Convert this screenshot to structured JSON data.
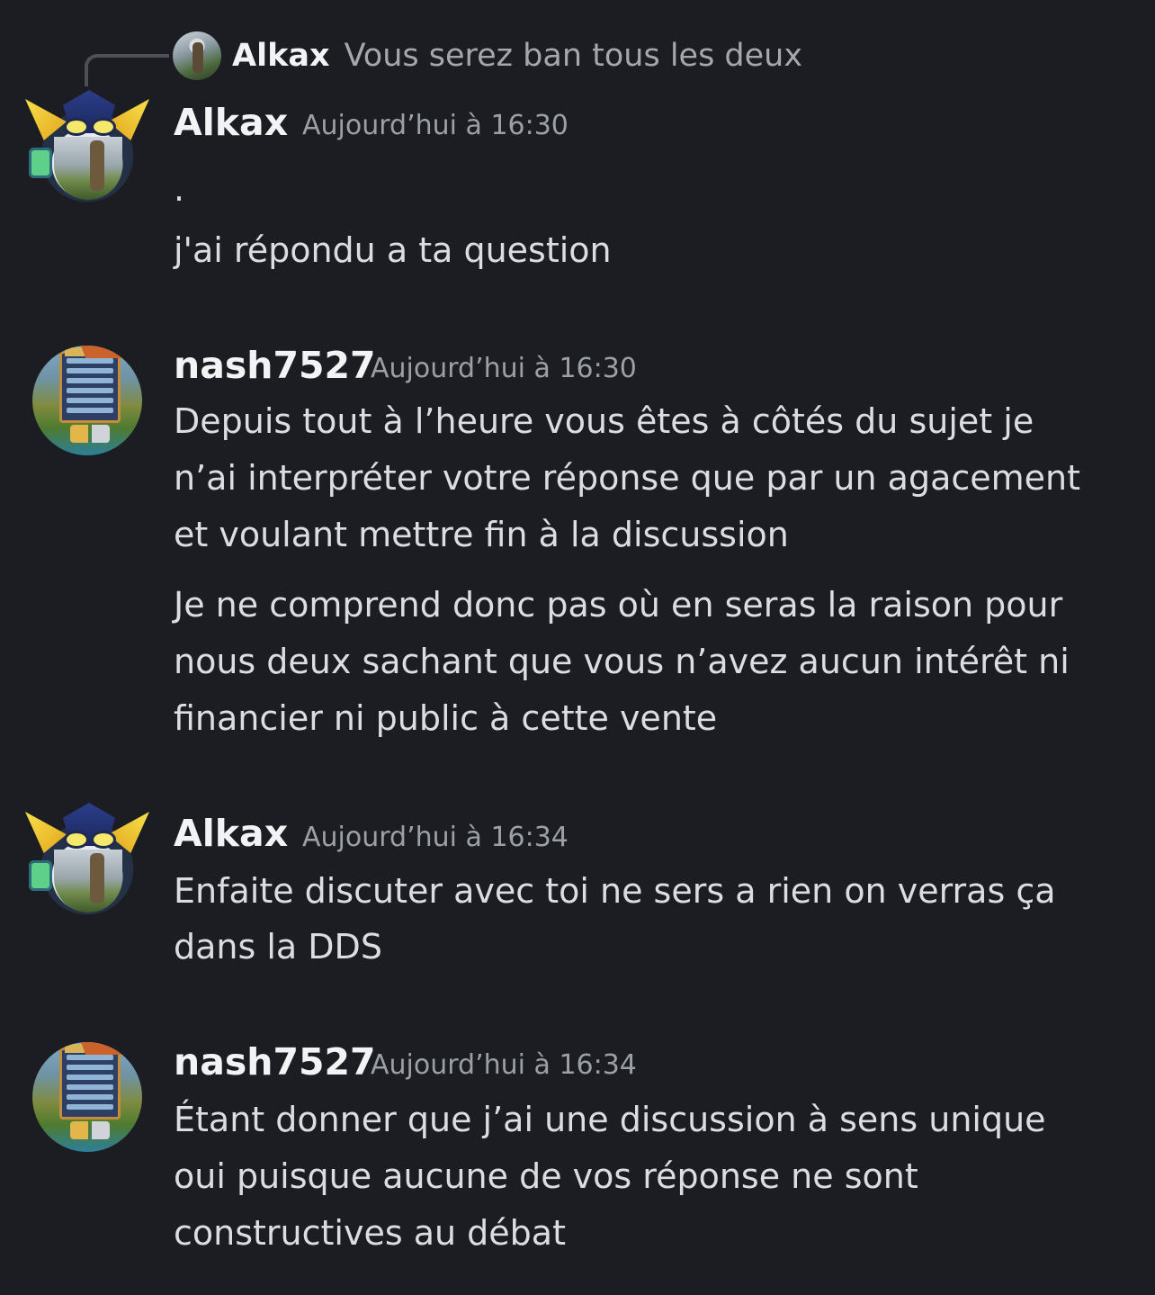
{
  "reply": {
    "author": "Alkax",
    "text": "Vous serez ban tous les deux"
  },
  "messages": [
    {
      "author": "Alkax",
      "timestamp": "Aujourd’hui à 16:30",
      "lines": [
        ".",
        "j'ai répondu a ta question"
      ]
    },
    {
      "author": "nash7527",
      "timestamp": "Aujourd’hui à 16:30",
      "lines": [
        "Depuis tout à l’heure vous êtes à côtés du sujet je",
        "n’ai interpréter votre réponse que par un agacement",
        "et voulant mettre fin à la discussion",
        "Je ne comprend donc pas où en seras la raison pour",
        "nous deux sachant que vous n’avez aucun intérêt ni",
        "financier ni public à cette vente"
      ]
    },
    {
      "author": "Alkax",
      "timestamp": "Aujourd’hui à 16:34",
      "lines": [
        "Enfaite discuter avec toi ne sers a rien on verras ça",
        "dans la DDS"
      ]
    },
    {
      "author": "nash7527",
      "timestamp": "Aujourd’hui à 16:34",
      "lines": [
        "Étant donner que j’ai une discussion à sens unique",
        "oui puisque aucune de vos réponse ne sont",
        "constructives au débat"
      ]
    }
  ],
  "colors": {
    "background": "#1c1d22",
    "username": "#f2f3f5",
    "timestamp": "#9b9fa6",
    "message_text": "#dbdee1",
    "reply_text": "#a4a7ad",
    "reply_spine": "#4e5058"
  }
}
